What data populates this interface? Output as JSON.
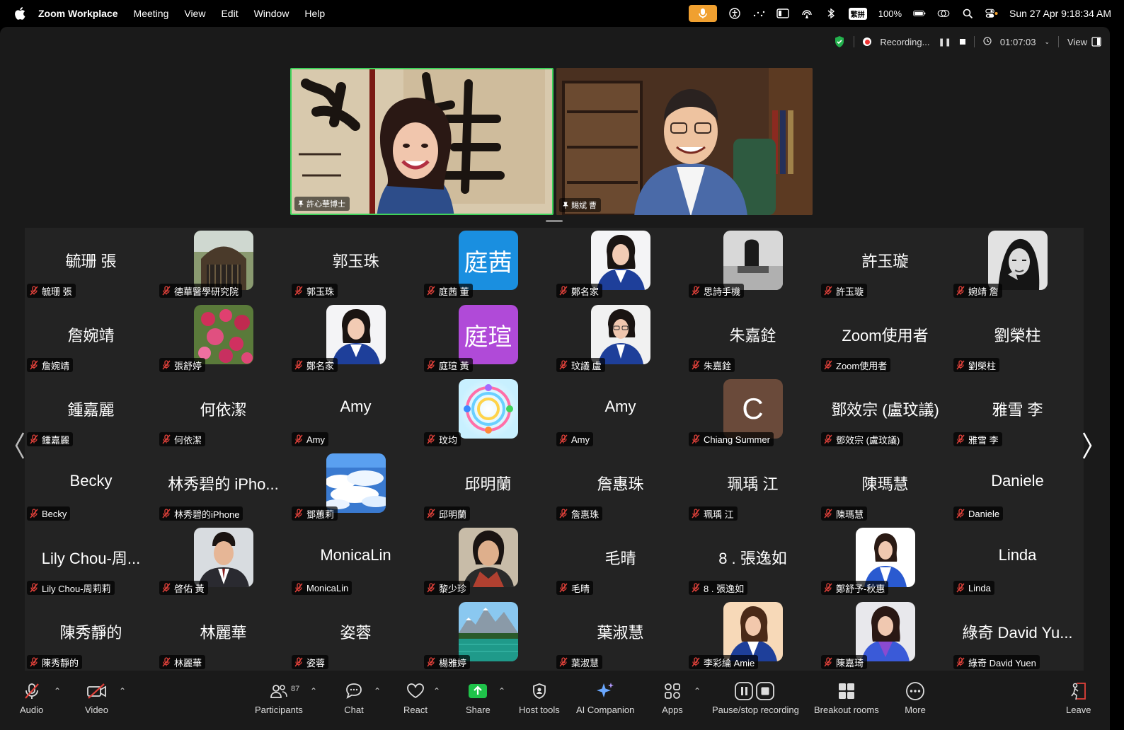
{
  "menubar": {
    "app_name": "Zoom Workplace",
    "items": [
      "Meeting",
      "View",
      "Edit",
      "Window",
      "Help"
    ],
    "battery": "100%",
    "datetime": "Sun 27 Apr  9:18:34 AM",
    "input_method": "繁拼"
  },
  "topbar": {
    "recording_label": "Recording...",
    "timer": "01:07:03",
    "view_label": "View"
  },
  "speakers": [
    {
      "name": "許心華博士"
    },
    {
      "name": "賜斌 曹"
    }
  ],
  "gallery": {
    "tiles": [
      {
        "big": "毓珊 張",
        "label": "毓珊 張",
        "avatar": ""
      },
      {
        "big": "",
        "label": "德華醫學研究院",
        "avatar": "building"
      },
      {
        "big": "郭玉珠",
        "label": "郭玉珠",
        "avatar": ""
      },
      {
        "big": "",
        "label": "庭茜 董",
        "avatar": "text-blue",
        "avatar_text": "庭茜"
      },
      {
        "big": "",
        "label": "鄭名家",
        "avatar": "portrait-blue"
      },
      {
        "big": "",
        "label": "思詩手機",
        "avatar": "bw-photo"
      },
      {
        "big": "許玉璇",
        "label": "許玉璇",
        "avatar": ""
      },
      {
        "big": "",
        "label": "婉靖 詹",
        "avatar": "bw-portrait"
      },
      {
        "big": "詹婉靖",
        "label": "詹婉靖",
        "avatar": ""
      },
      {
        "big": "",
        "label": "張舒婷",
        "avatar": "flowers"
      },
      {
        "big": "",
        "label": "鄭名家",
        "avatar": "portrait-blue"
      },
      {
        "big": "",
        "label": "庭瑄 黃",
        "avatar": "text-purple",
        "avatar_text": "庭瑄"
      },
      {
        "big": "",
        "label": "玟議 盧",
        "avatar": "portrait-glasses"
      },
      {
        "big": "朱嘉銓",
        "label": "朱嘉銓",
        "avatar": ""
      },
      {
        "big": "Zoom使用者",
        "label": "Zoom使用者",
        "avatar": ""
      },
      {
        "big": "劉榮柱",
        "label": "劉榮柱",
        "avatar": ""
      },
      {
        "big": "鍾嘉麗",
        "label": "鍾嘉麗",
        "avatar": ""
      },
      {
        "big": "何依潔",
        "label": "何依潔",
        "avatar": ""
      },
      {
        "big": "Amy",
        "label": "Amy",
        "avatar": ""
      },
      {
        "big": "",
        "label": "玟均",
        "avatar": "mandala"
      },
      {
        "big": "Amy",
        "label": "Amy",
        "avatar": ""
      },
      {
        "big": "",
        "label": "Chiang Summer",
        "avatar": "letter",
        "avatar_text": "C"
      },
      {
        "big": "鄧效宗 (盧玟議)",
        "label": "鄧效宗 (盧玟議)",
        "avatar": ""
      },
      {
        "big": "雅雪 李",
        "label": "雅雪 李",
        "avatar": ""
      },
      {
        "big": "Becky",
        "label": "Becky",
        "avatar": ""
      },
      {
        "big": "林秀碧的 iPho...",
        "label": "林秀碧的iPhone",
        "avatar": ""
      },
      {
        "big": "",
        "label": "鄧蕙莉",
        "avatar": "clouds"
      },
      {
        "big": "邱明蘭",
        "label": "邱明蘭",
        "avatar": ""
      },
      {
        "big": "詹惠珠",
        "label": "詹惠珠",
        "avatar": ""
      },
      {
        "big": "珮瑀 江",
        "label": "珮瑀 江",
        "avatar": ""
      },
      {
        "big": "陳瑪慧",
        "label": "陳瑪慧",
        "avatar": ""
      },
      {
        "big": "Daniele",
        "label": "Daniele",
        "avatar": ""
      },
      {
        "big": "Lily Chou-周...",
        "label": "Lily Chou-周莉莉",
        "avatar": ""
      },
      {
        "big": "",
        "label": "啓佑 黃",
        "avatar": "portrait-man"
      },
      {
        "big": "MonicaLin",
        "label": "MonicaLin",
        "avatar": ""
      },
      {
        "big": "",
        "label": "黎少珍",
        "avatar": "portrait-woman-dark"
      },
      {
        "big": "毛晴",
        "label": "毛晴",
        "avatar": ""
      },
      {
        "big": "8 . 張逸如",
        "label": "8 . 張逸如",
        "avatar": ""
      },
      {
        "big": "",
        "label": "鄭舒予-秋惠",
        "avatar": "portrait-blue-white"
      },
      {
        "big": "Linda",
        "label": "Linda",
        "avatar": ""
      },
      {
        "big": "陳秀靜的",
        "label": "陳秀靜的",
        "avatar": ""
      },
      {
        "big": "林麗華",
        "label": "林麗華",
        "avatar": ""
      },
      {
        "big": "姿蓉",
        "label": "姿蓉",
        "avatar": ""
      },
      {
        "big": "",
        "label": "楊雅婷",
        "avatar": "lake"
      },
      {
        "big": "葉淑慧",
        "label": "葉淑慧",
        "avatar": ""
      },
      {
        "big": "",
        "label": "李彩綸 Amie",
        "avatar": "portrait-amie"
      },
      {
        "big": "",
        "label": "陳嘉琦",
        "avatar": "portrait-purple"
      },
      {
        "big": "綠奇 David Yu...",
        "label": "綠奇 David Yuen",
        "avatar": ""
      }
    ]
  },
  "toolbar": {
    "audio": "Audio",
    "video": "Video",
    "participants": "Participants",
    "participants_count": "87",
    "chat": "Chat",
    "react": "React",
    "share": "Share",
    "host_tools": "Host tools",
    "ai_companion": "AI Companion",
    "apps": "Apps",
    "pause_stop": "Pause/stop recording",
    "breakout": "Breakout rooms",
    "more": "More",
    "leave": "Leave"
  },
  "colors": {
    "active_speaker_border": "#3fd35a",
    "share_green": "#1fc34a",
    "mute_red": "#e0413a",
    "mic_pill": "#f0a030"
  }
}
